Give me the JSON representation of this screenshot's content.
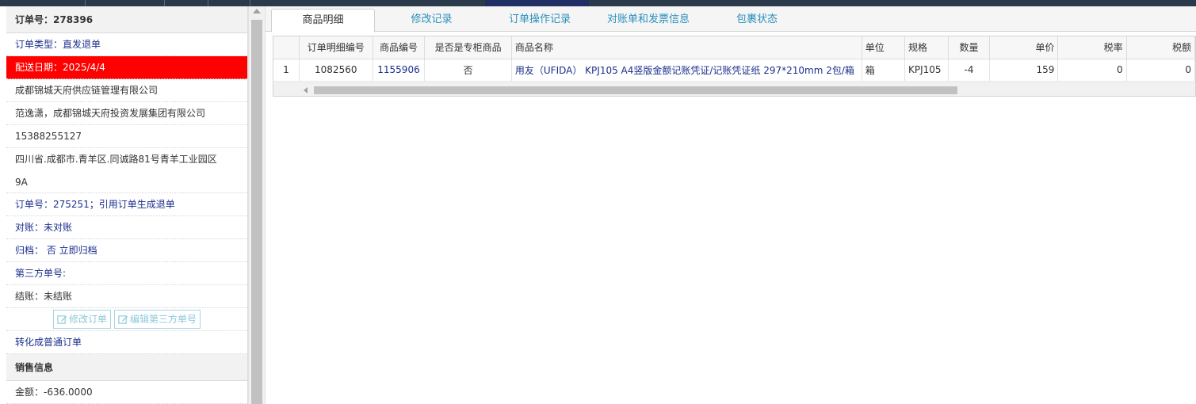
{
  "order": {
    "title": "订单号：278396",
    "type": "订单类型：直发退单",
    "delivery_date": "配送日期：2025/4/4",
    "supplier": "成都锦城天府供应链管理有限公司",
    "customer": "范逸潇，成都锦城天府投资发展集团有限公司",
    "phone": "15388255127",
    "address_line1": "四川省.成都市.青羊区.同诚路81号青羊工业园区",
    "address_line2": "9A",
    "ref_order": "订单号：275251；引用订单生成退单",
    "reconcile": "对账：未对账",
    "archive": "归档： 否 立即归档",
    "third_party": "第三方单号:",
    "settlement": "结账：未结账",
    "modify_button": "修改订单",
    "edit_third_button": "编辑第三方单号",
    "convert_link": "转化成普通订单"
  },
  "sales": {
    "title": "销售信息",
    "amount": "金额：-636.0000"
  },
  "tabs": [
    {
      "label": "商品明细"
    },
    {
      "label": "修改记录"
    },
    {
      "label": "订单操作记录"
    },
    {
      "label": "对账单和发票信息"
    },
    {
      "label": "包裹状态"
    }
  ],
  "table": {
    "headers": [
      "",
      "订单明细编号",
      "商品编号",
      "是否是专柜商品",
      "商品名称",
      "单位",
      "规格",
      "数量",
      "单价",
      "税率",
      "税额"
    ],
    "rows": [
      [
        "1",
        "1082560",
        "1155906",
        "否",
        "用友（UFIDA） KPJ105 A4竖版金额记账凭证/记账凭证纸 297*210mm 2包/箱",
        "箱",
        "KPJ105",
        "-4",
        "159",
        "0",
        "0"
      ]
    ]
  },
  "colors": {
    "highlight_row": "#ff0000",
    "link": "#1b2f8c",
    "tab_text": "#2a8fbd"
  }
}
